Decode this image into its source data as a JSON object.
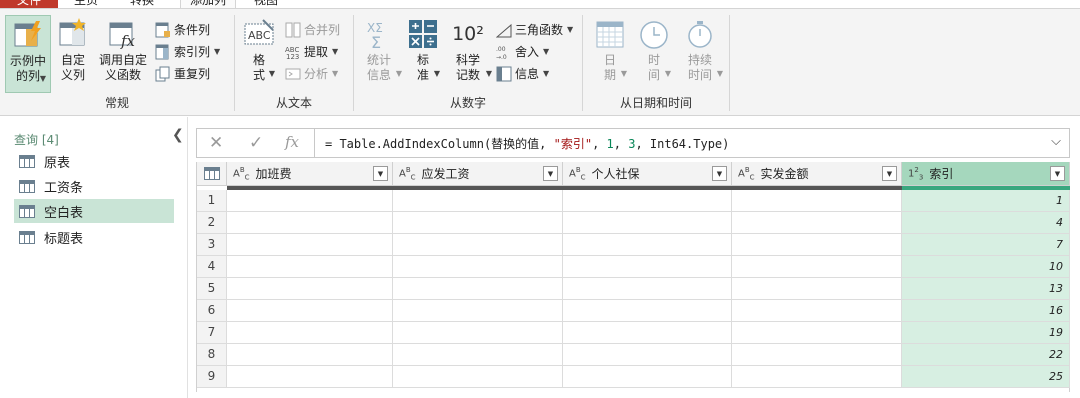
{
  "tabs": [
    {
      "label": "文件",
      "active": false
    },
    {
      "label": "主页",
      "active": false
    },
    {
      "label": "转换",
      "active": false
    },
    {
      "label": "添加列",
      "active": true
    },
    {
      "label": "视图",
      "active": false
    }
  ],
  "ribbon": {
    "general": {
      "group_label": "常规",
      "example_col": "示例中\n的列",
      "custom_col": "自定\n义列",
      "invoke_custom": "调用自定\n义函数",
      "conditional_col": "条件列",
      "index_col": "索引列",
      "duplicate_col": "重复列"
    },
    "from_text": {
      "group_label": "从文本",
      "format": "格\n式",
      "merge_cols": "合并列",
      "extract": "提取",
      "parse": "分析"
    },
    "from_number": {
      "group_label": "从数字",
      "statistics": "统计\n信息",
      "standard": "标\n准",
      "scientific": "科学\n记数",
      "sci_glyph": "10²",
      "trig": "三角函数",
      "rounding": "舍入",
      "information": "信息"
    },
    "from_datetime": {
      "group_label": "从日期和时间",
      "date": "日\n期",
      "time": "时\n间",
      "duration": "持续\n时间"
    }
  },
  "queries": {
    "title": "查询 [4]",
    "items": [
      {
        "label": "原表",
        "selected": false
      },
      {
        "label": "工资条",
        "selected": false
      },
      {
        "label": "空白表",
        "selected": true
      },
      {
        "label": "标题表",
        "selected": false
      }
    ]
  },
  "formula_bar": {
    "cancel": "✕",
    "confirm": "✓",
    "fx": "fx",
    "prefix": "= Table.AddIndexColumn(替换的值, ",
    "str": "\"索引\"",
    "sep1": ", ",
    "n1": "1",
    "sep2": ", ",
    "n2": "3",
    "suffix": ", Int64.Type)"
  },
  "table": {
    "columns": [
      {
        "type": "ABC",
        "name": "加班费"
      },
      {
        "type": "ABC",
        "name": "应发工资"
      },
      {
        "type": "ABC",
        "name": "个人社保"
      },
      {
        "type": "ABC",
        "name": "实发金额"
      },
      {
        "type": "123",
        "name": "索引"
      }
    ],
    "row_numbers": [
      "1",
      "2",
      "3",
      "4",
      "5",
      "6",
      "7",
      "8",
      "9"
    ],
    "index_values": [
      "1",
      "4",
      "7",
      "10",
      "13",
      "16",
      "19",
      "22",
      "25"
    ]
  },
  "colors": {
    "accent_green": "#a5d7bd",
    "selection_green": "#c9e4d6",
    "file_tab_red": "#c0392b"
  }
}
